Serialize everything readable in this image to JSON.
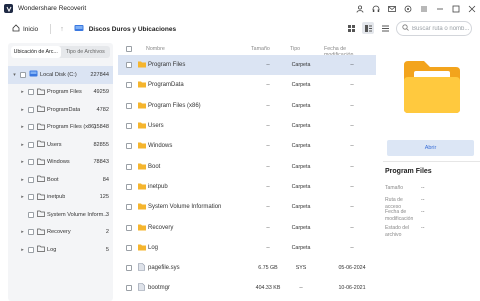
{
  "app": {
    "title": "Wondershare Recoverit"
  },
  "toolbar": {
    "home_label": "Inicio",
    "breadcrumb": "Discos Duros y Ubicaciones",
    "search_placeholder": "Buscar ruta o nomb..."
  },
  "leftpane": {
    "tabs": [
      {
        "label": "Ubicación de Arc..."
      },
      {
        "label": "Tipo de Archivos"
      }
    ],
    "tree": [
      {
        "label": "Local Disk (C:)",
        "count": "227844"
      },
      {
        "label": "Program Files",
        "count": "49259"
      },
      {
        "label": "ProgramData",
        "count": "4782"
      },
      {
        "label": "Program Files (x86)",
        "count": "15848"
      },
      {
        "label": "Users",
        "count": "82855"
      },
      {
        "label": "Windows",
        "count": "78843"
      },
      {
        "label": "Boot",
        "count": "84"
      },
      {
        "label": "inetpub",
        "count": "125"
      },
      {
        "label": "System Volume Inform...",
        "count": "3"
      },
      {
        "label": "Recovery",
        "count": "2"
      },
      {
        "label": "Log",
        "count": "5"
      }
    ]
  },
  "filelist": {
    "headers": {
      "name": "Nombre",
      "size": "Tamaño",
      "type": "Tipo",
      "modified": "Fecha de modificación"
    },
    "rows": [
      {
        "name": "Program Files",
        "size": "--",
        "type": "Carpeta",
        "modified": "--"
      },
      {
        "name": "ProgramData",
        "size": "--",
        "type": "Carpeta",
        "modified": "--"
      },
      {
        "name": "Program Files (x86)",
        "size": "--",
        "type": "Carpeta",
        "modified": "--"
      },
      {
        "name": "Users",
        "size": "--",
        "type": "Carpeta",
        "modified": "--"
      },
      {
        "name": "Windows",
        "size": "--",
        "type": "Carpeta",
        "modified": "--"
      },
      {
        "name": "Boot",
        "size": "--",
        "type": "Carpeta",
        "modified": "--"
      },
      {
        "name": "inetpub",
        "size": "--",
        "type": "Carpeta",
        "modified": "--"
      },
      {
        "name": "System Volume Information",
        "size": "--",
        "type": "Carpeta",
        "modified": "--"
      },
      {
        "name": "Recovery",
        "size": "--",
        "type": "Carpeta",
        "modified": "--"
      },
      {
        "name": "Log",
        "size": "--",
        "type": "Carpeta",
        "modified": "--"
      },
      {
        "name": "pagefile.sys",
        "size": "6.75 GB",
        "type": "SYS",
        "modified": "05-06-2024"
      },
      {
        "name": "bootmgr",
        "size": "404.33 KB",
        "type": "--",
        "modified": "10-06-2021"
      }
    ]
  },
  "details": {
    "open_label": "Abrir",
    "title": "Program Files",
    "props": [
      {
        "label": "Tamaño",
        "value": "--"
      },
      {
        "label": "Ruta de acceso",
        "value": "--"
      },
      {
        "label": "Fecha de modificación",
        "value": "--"
      },
      {
        "label": "Estado del archivo",
        "value": "--"
      }
    ]
  },
  "colors": {
    "accent": "#3a6fd8",
    "selection": "#dbe4f3",
    "folder": "#f5b52e"
  },
  "icons": [
    "app-logo-icon",
    "user-icon",
    "headset-icon",
    "mail-icon",
    "settings-icon",
    "menu-icon",
    "minimize-icon",
    "maximize-icon",
    "close-icon",
    "home-icon",
    "up-arrow-icon",
    "drive-icon",
    "grid-view-icon",
    "detail-view-icon",
    "list-view-icon",
    "search-icon",
    "folder-icon",
    "file-icon"
  ]
}
